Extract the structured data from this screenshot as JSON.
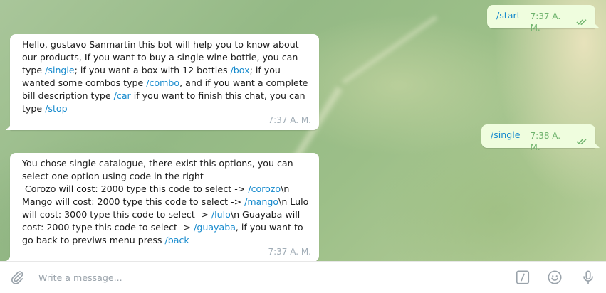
{
  "colors": {
    "link": "#168acd",
    "incoming_bubble": "#ffffff",
    "outgoing_bubble": "#effdde",
    "outgoing_meta": "#6fb36d",
    "incoming_meta": "#a0acb6"
  },
  "messages": {
    "m1": {
      "text": "/start",
      "time": "7:37 A. M."
    },
    "m2": {
      "p1": "Hello, gustavo Sanmartin this bot will help you to know about our products, If you want to buy a single wine bottle, you can type ",
      "c1": "/single",
      "p2": "; if you want a box with 12 bottles ",
      "c2": "/box",
      "p3": "; if you wanted some combos type ",
      "c3": "/combo",
      "p4": ", and if you want a complete bill description type ",
      "c4": "/car",
      "p5": " if you want to finish this chat, you can type ",
      "c5": "/stop",
      "time": "7:37 A. M."
    },
    "m3": {
      "text": "/single",
      "time": "7:38 A. M."
    },
    "m4": {
      "p1": "You chose single catalogue, there exist this options, you can select one option using code in the right\n Corozo will cost: 2000 type this code to select -> ",
      "c1": "/corozo",
      "p2": "\\n Mango will cost: 2000 type this code to select -> ",
      "c2": "/mango",
      "p3": "\\n Lulo will cost: 3000 type this code to select -> ",
      "c3": "/lulo",
      "p4": "\\n Guayaba will cost: 2000 type this code to select -> ",
      "c4": "/guayaba",
      "p5": ", if you want to go back to previws menu press ",
      "c5": "/back",
      "time": "7:37 A. M."
    }
  },
  "composer": {
    "placeholder": "Write a message...",
    "icons": {
      "attach": "paperclip-icon",
      "commands": "slash-command-icon",
      "emoji": "emoji-icon",
      "voice": "microphone-icon"
    }
  }
}
